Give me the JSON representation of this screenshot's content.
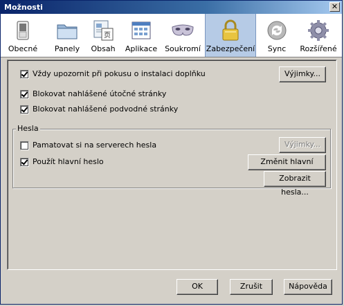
{
  "window": {
    "title": "Možnosti",
    "close_glyph": "✕"
  },
  "tabs": [
    {
      "id": "obecne",
      "label": "Obecné",
      "icon": "switch-icon"
    },
    {
      "id": "panely",
      "label": "Panely",
      "icon": "folder-tabs-icon"
    },
    {
      "id": "obsah",
      "label": "Obsah",
      "icon": "page-content-icon"
    },
    {
      "id": "aplikace",
      "label": "Aplikace",
      "icon": "applications-icon"
    },
    {
      "id": "soukromi",
      "label": "Soukromí",
      "icon": "mask-icon"
    },
    {
      "id": "zabezpeceni",
      "label": "Zabezpečení",
      "icon": "padlock-icon",
      "selected": true
    },
    {
      "id": "sync",
      "label": "Sync",
      "icon": "sync-icon"
    },
    {
      "id": "rozsirene",
      "label": "Rozšířené",
      "icon": "gear-icon"
    }
  ],
  "security": {
    "warn_addons": {
      "label": "Vždy upozornit při pokusu o instalaci doplňku",
      "checked": true
    },
    "exceptions_button": "Výjimky...",
    "block_attack": {
      "label": "Blokovat nahlášené útočné stránky",
      "checked": true
    },
    "block_forgery": {
      "label": "Blokovat nahlášené podvodné stránky",
      "checked": true
    }
  },
  "passwords": {
    "group_title": "Hesla",
    "remember": {
      "label": "Pamatovat si na serverech hesla",
      "checked": false
    },
    "exceptions_button": "Výjimky...",
    "master": {
      "label": "Použít hlavní heslo",
      "checked": true
    },
    "change_master_button": "Změnit hlavní heslo...",
    "show_passwords_button": "Zobrazit hesla..."
  },
  "footer": {
    "ok": "OK",
    "cancel": "Zrušit",
    "help": "Nápověda"
  },
  "colors": {
    "titlebar": "#0a246a",
    "selected_tab": "#b6cbe6",
    "dialog_bg": "#d4d0c8"
  }
}
